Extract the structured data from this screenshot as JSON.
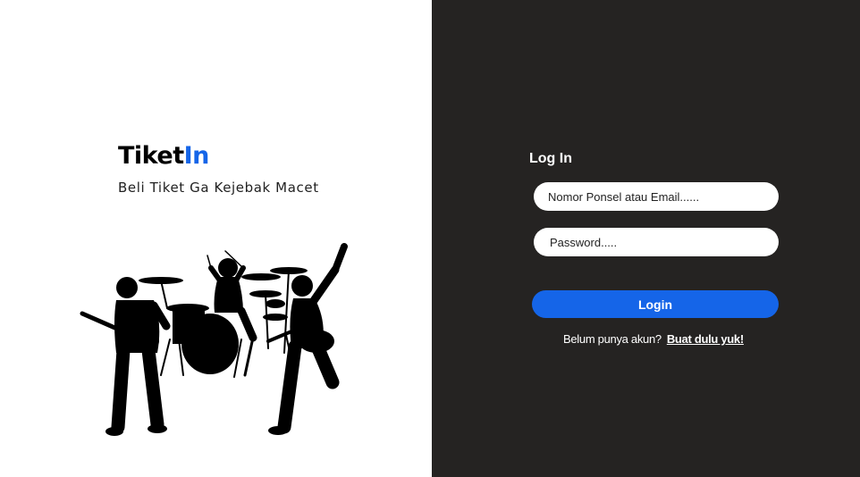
{
  "brand": {
    "name_part1": "Tiket",
    "name_part2": "In",
    "tagline": "Beli Tiket Ga Kejebak Macet",
    "accent_color": "#1565e8"
  },
  "illustration": {
    "icon": "rock-band-silhouette-icon"
  },
  "login": {
    "title": "Log In",
    "email_placeholder": "Nomor Ponsel atau Email......",
    "password_placeholder": "Password.....",
    "submit_label": "Login",
    "signup_prompt": "Belum punya akun?",
    "signup_link": "Buat dulu yuk!",
    "panel_color": "#252322",
    "button_color": "#1565e8"
  }
}
